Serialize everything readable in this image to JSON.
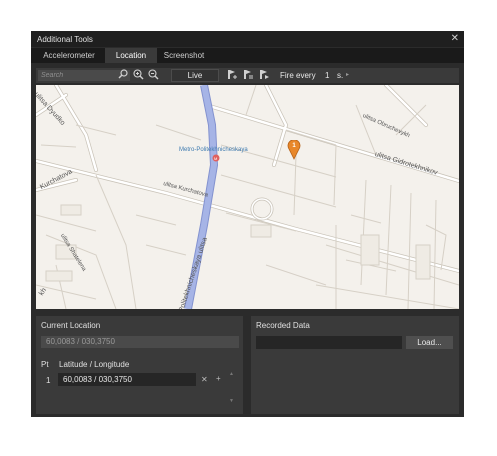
{
  "window": {
    "title": "Additional Tools",
    "close_glyph": "✕"
  },
  "tabs": [
    {
      "label": "Accelerometer",
      "active": false
    },
    {
      "label": "Location",
      "active": true
    },
    {
      "label": "Screenshot",
      "active": false
    }
  ],
  "toolbar": {
    "search_placeholder": "Search",
    "search_icon": "search-icon",
    "zoom_in_icon": "zoom-in-icon",
    "zoom_out_icon": "zoom-out-icon",
    "live_label": "Live",
    "route_icons": [
      "add-route-point-icon",
      "route-icon",
      "route-play-icon"
    ],
    "fire_every_label": "Fire every",
    "fire_every_value": "1",
    "fire_every_unit": "s.",
    "fire_every_arrow": "▸"
  },
  "map": {
    "labels": {
      "metro": "Metro-Politekhnicheskaya",
      "gidrotekhnikov": "ulitsa Gidrotekhnikov",
      "obruchevykh": "ulitsa Obruchevykh",
      "kurchatova": "ulitsa Kurchatova",
      "kurchatova_left": "Kurchatova",
      "politekhnicheskaya": "Politekhnicheskaya ulitsa",
      "shatelena": "ulitsa Shatelena",
      "dyudko": "ulitsa Dyudko",
      "left_edge": "kh"
    },
    "marker_label": "1",
    "colors": {
      "background": "#f4f1ec",
      "road": "#ffffff",
      "road_outline": "#c9c3b8",
      "main_road": "#a6b4e6",
      "marker": "#e8872a"
    }
  },
  "current_location": {
    "title": "Current Location",
    "value": "60,0083 / 030,3750"
  },
  "points": {
    "col_pt": "Pt",
    "col_latlng": "Latitude / Longitude",
    "rows": [
      {
        "index": "1",
        "value": "60,0083 /  030,3750"
      }
    ],
    "remove_glyph": "✕",
    "move_glyph": "+",
    "scroll_up_glyph": "▲",
    "scroll_down_glyph": "▼"
  },
  "recorded_data": {
    "title": "Recorded Data",
    "load_label": "Load..."
  }
}
